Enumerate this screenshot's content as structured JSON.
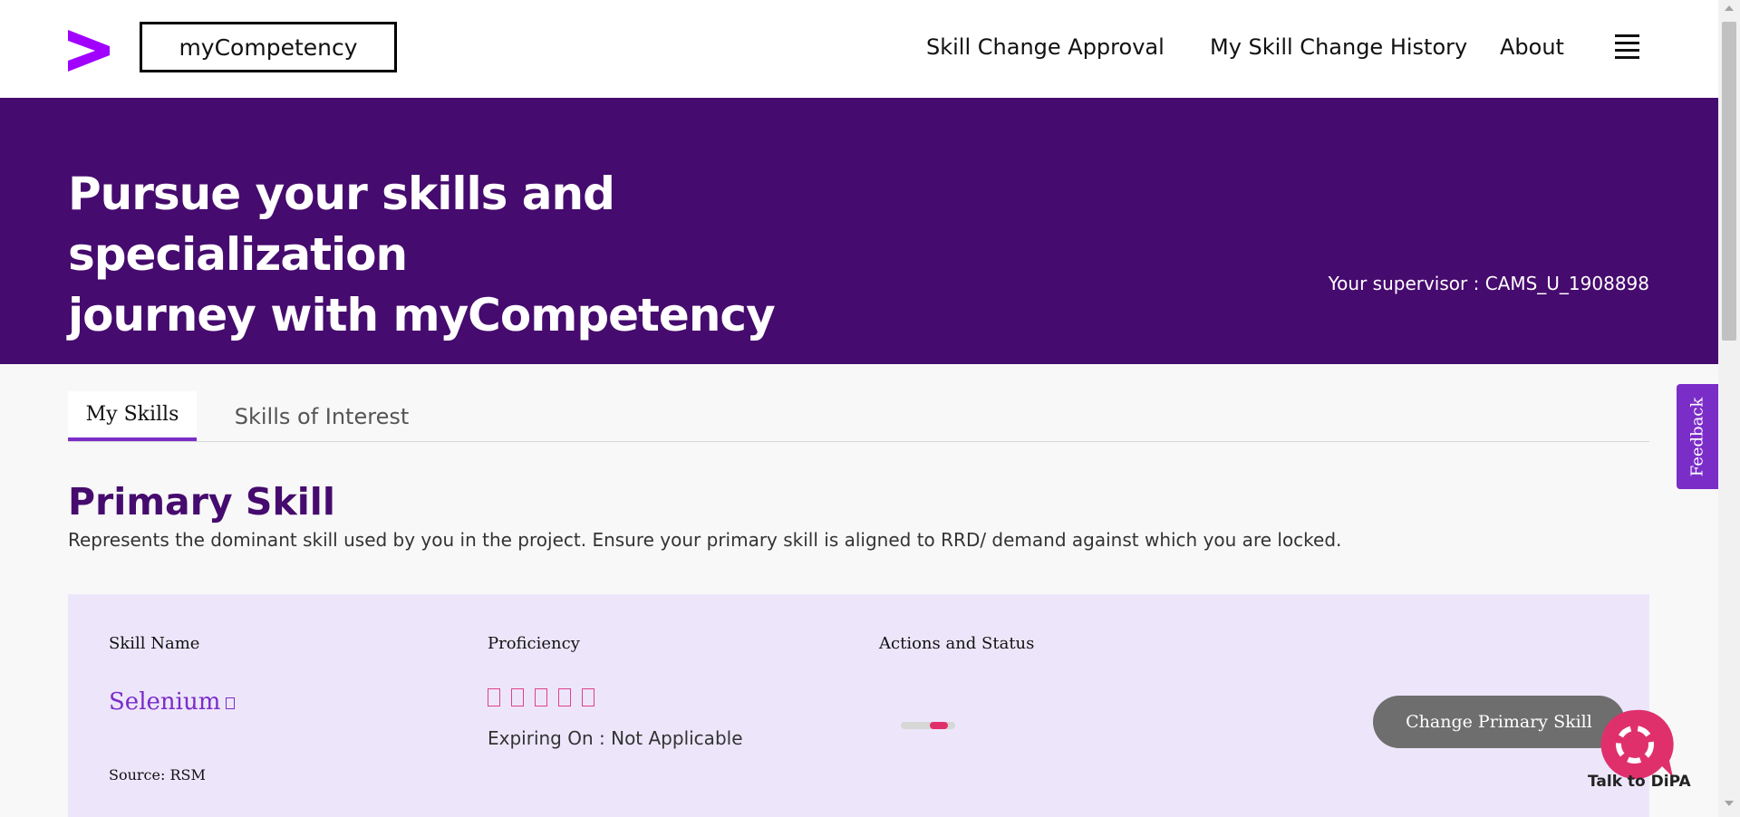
{
  "header": {
    "app_name": "myCompetency",
    "nav": [
      "Skill Change Approval",
      "My Skill Change History",
      "About"
    ],
    "brand_color": "#a100ff"
  },
  "hero": {
    "title_line1": "Pursue your skills and specialization",
    "title_line2": "journey with myCompetency",
    "supervisor": "Your supervisor : CAMS_U_1908898",
    "background": "#460b6e"
  },
  "tabs": [
    {
      "label": "My Skills",
      "active": true
    },
    {
      "label": "Skills of Interest",
      "active": false
    }
  ],
  "primary_skill": {
    "title": "Primary Skill",
    "description": "Represents the dominant skill used by you in the project. Ensure your primary skill is aligned to RRD/ demand against which you are locked.",
    "columns": [
      "Skill Name",
      "Proficiency",
      "Actions and Status"
    ],
    "skill_name": "Selenium",
    "source": "Source: RSM",
    "proficiency_stars": 5,
    "expiry": "Expiring On : Not Applicable",
    "change_button": "Change Primary Skill",
    "icons": [
      "info-icon",
      "star-icon",
      "loading-indicator"
    ]
  },
  "feedback_label": "Feedback",
  "dipa_label": "Talk to DiPA"
}
